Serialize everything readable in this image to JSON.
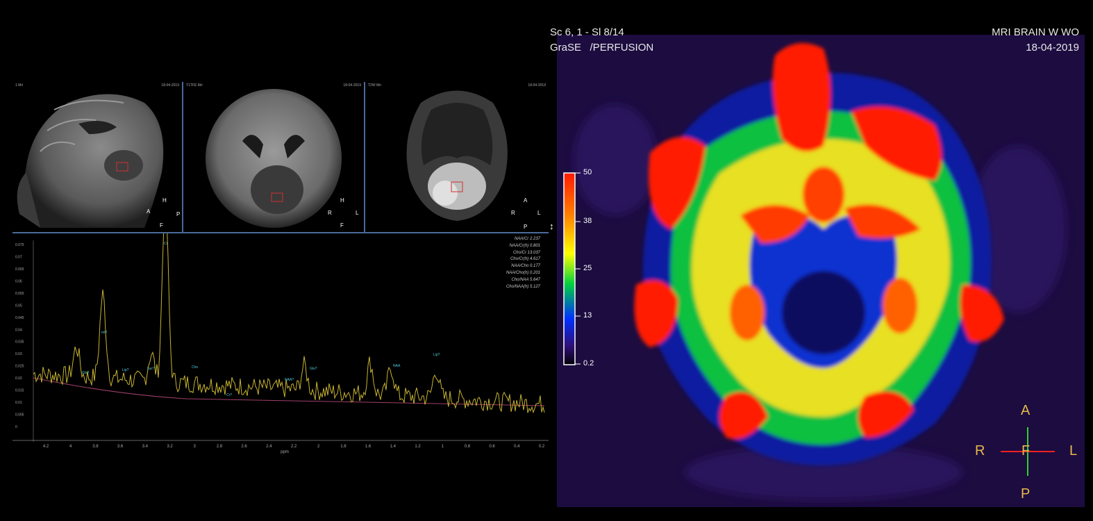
{
  "left": {
    "views": [
      {
        "name": "sagittal",
        "header_left": "1  Mri",
        "header_right": "18-04-2019",
        "orientation": {
          "top": "H",
          "left": "A",
          "right": "P",
          "bottom": "F"
        }
      },
      {
        "name": "coronal",
        "header_left": "T1TFE  Mri",
        "header_right": "18-04-2019",
        "orientation": {
          "top": "H",
          "left": "R",
          "right": "L",
          "bottom": "F"
        }
      },
      {
        "name": "axial",
        "header_left": "T2W  Mri",
        "header_right": "18-04-2019",
        "orientation": {
          "top": "A",
          "left": "R",
          "right": "L",
          "bottom": "P"
        }
      }
    ],
    "spectrum": {
      "xlabel": "ppm",
      "x_ticks": [
        "4.2",
        "4",
        "3.8",
        "3.6",
        "3.4",
        "3.2",
        "3",
        "2.8",
        "2.6",
        "2.4",
        "2.2",
        "2",
        "1.8",
        "1.6",
        "1.4",
        "1.2",
        "1",
        "0.8",
        "0.6",
        "0.4",
        "0.2"
      ],
      "y_ticks": [
        "0.075",
        "0.07",
        "0.065",
        "0.06",
        "0.055",
        "0.05",
        "0.045",
        "0.04",
        "0.035",
        "0.03",
        "0.025",
        "0.02",
        "0.015",
        "0.01",
        "0.005",
        "0"
      ],
      "peak_labels": [
        "Glx?",
        "Cr",
        "mI?",
        "Cho",
        "Cr?",
        "NAA?",
        "Glu?",
        "NAA",
        "Lip?",
        "Lac?",
        "Lip?"
      ],
      "ratios": [
        {
          "label": "NAA/Cr",
          "value": "2.237"
        },
        {
          "label": "NAA/Cr(h)",
          "value": "0.801"
        },
        {
          "label": "Cho/Cr",
          "value": "13.037"
        },
        {
          "label": "Cho/Cr(h)",
          "value": "4.617"
        },
        {
          "label": "NAA/Cho",
          "value": "0.177"
        },
        {
          "label": "NAA/Cho(h)",
          "value": "0.201"
        },
        {
          "label": "Cho/NAA",
          "value": "5.647"
        },
        {
          "label": "Cho/NAA(h)",
          "value": "5.127"
        }
      ]
    }
  },
  "right": {
    "top_left_line1": "Sc 6, 1 - Sl 8/14",
    "top_left_line2": "GraSE   /PERFUSION",
    "top_right_line1": "MRI BRAIN W WO",
    "top_right_line2": "18-04-2019",
    "colorbar_labels": [
      "50",
      "38",
      "25",
      "13",
      "0.2"
    ],
    "orientation": {
      "top": "A",
      "left": "R",
      "center": "F",
      "right": "L",
      "bottom": "P"
    }
  },
  "colors": {
    "divider": "#4a6a9a",
    "spectrum": "#c8b430",
    "baseline": "#a0406a",
    "annotation": "#4fd0e0",
    "orient_letters": "#e8b84a"
  }
}
